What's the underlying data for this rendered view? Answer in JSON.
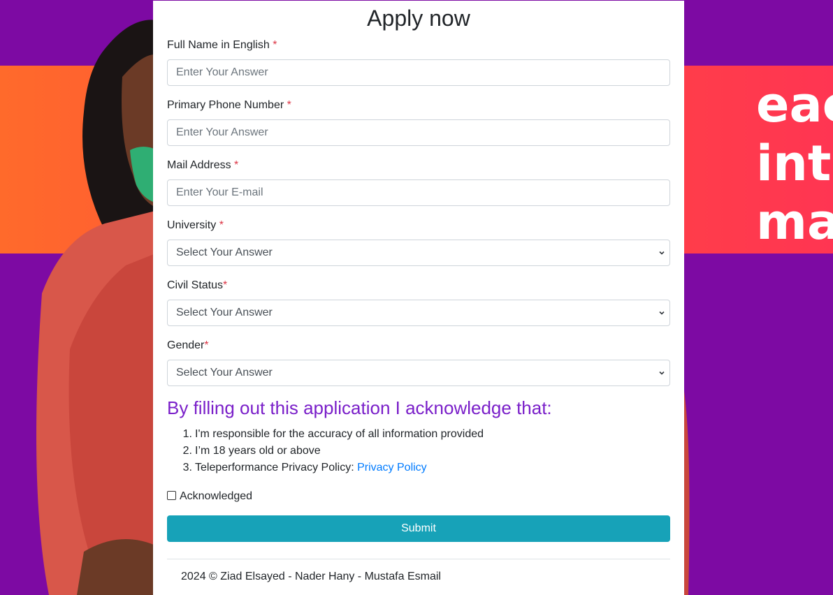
{
  "colors": {
    "background_purple": "#7d0aa3",
    "banner_orange": "#ff5a2a",
    "banner_red": "#ff3b4f",
    "acknowledge_heading": "#7a1fc9",
    "required_star": "#dc3545",
    "link": "#007bff",
    "submit_button": "#17a2b8"
  },
  "banner": {
    "lines": [
      "eac",
      "inte",
      "mat"
    ]
  },
  "form": {
    "title": "Apply now",
    "fields": [
      {
        "label": "Full Name in English",
        "required_mark": "*",
        "type": "text",
        "placeholder": "Enter Your Answer"
      },
      {
        "label": "Primary Phone Number",
        "required_mark": "*",
        "type": "text",
        "placeholder": "Enter Your Answer"
      },
      {
        "label": "Mail Address",
        "required_mark": "*",
        "type": "email",
        "placeholder": "Enter Your E-mail"
      },
      {
        "label": "University",
        "required_mark": "*",
        "type": "select",
        "selected": "Select Your Answer"
      },
      {
        "label": "Civil Status",
        "required_mark": "*",
        "type": "select",
        "selected": "Select Your Answer"
      },
      {
        "label": "Gender",
        "required_mark": "*",
        "type": "select",
        "selected": "Select Your Answer"
      }
    ],
    "acknowledge": {
      "heading": "By filling out this application I acknowledge that:",
      "items": [
        {
          "number": "1.",
          "text": "I'm responsible for the accuracy of all information provided"
        },
        {
          "number": "2.",
          "text": "I’m 18 years old or above"
        },
        {
          "number": "3.",
          "text": "Teleperformance Privacy Policy: ",
          "link": "Privacy Policy"
        }
      ],
      "checkbox_label": "Acknowledged",
      "checked": false
    },
    "submit_label": "Submit",
    "footer": "2024 © Ziad Elsayed - Nader Hany - Mustafa Esmail"
  }
}
